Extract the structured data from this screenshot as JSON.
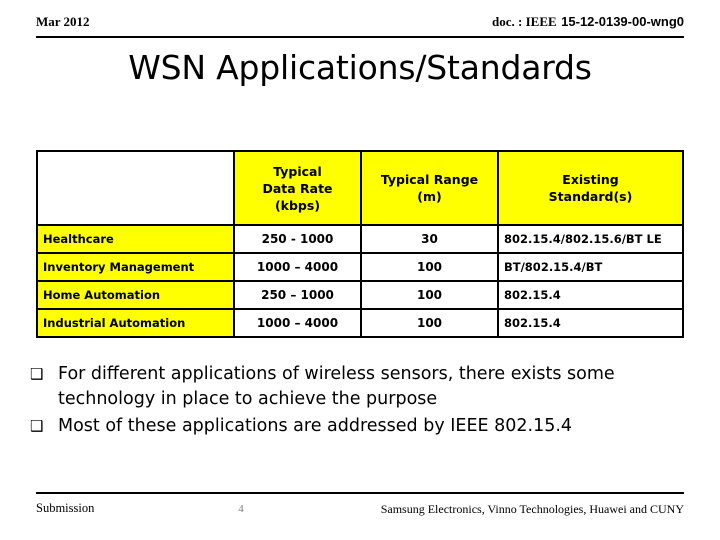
{
  "header": {
    "date": "Mar 2012",
    "doc_label": "doc. : IEEE",
    "doc_number": "15-12-0139-00-wng0"
  },
  "title": "WSN Applications/Standards",
  "table": {
    "columns": [
      {
        "lines": [
          ""
        ]
      },
      {
        "lines": [
          "Typical",
          "Data Rate",
          "(kbps)"
        ]
      },
      {
        "lines": [
          "Typical Range",
          "(m)"
        ]
      },
      {
        "lines": [
          "Existing",
          "Standard(s)"
        ]
      }
    ],
    "rows": [
      {
        "application": "Healthcare",
        "data_rate": "250 - 1000",
        "range": "30",
        "standards": "802.15.4/802.15.6/BT LE"
      },
      {
        "application": "Inventory Management",
        "data_rate": "1000 – 4000",
        "range": "100",
        "standards": "BT/802.15.4/BT"
      },
      {
        "application": "Home Automation",
        "data_rate": "250 – 1000",
        "range": "100",
        "standards": "802.15.4"
      },
      {
        "application": "Industrial Automation",
        "data_rate": "1000 – 4000",
        "range": "100",
        "standards": "802.15.4"
      }
    ]
  },
  "bullets": [
    {
      "glyph": "❑",
      "text": "For different applications of wireless sensors, there exists some technology in place to achieve the purpose"
    },
    {
      "glyph": "❑",
      "text": "Most of these applications are addressed by IEEE 802.15.4"
    }
  ],
  "footer": {
    "submission": "Submission",
    "page": "4",
    "affiliation": "Samsung Electronics, Vinno Technologies, Huawei and CUNY"
  },
  "colors": {
    "highlight": "#FFFF00",
    "text": "#000000",
    "page_number": "#808080"
  }
}
